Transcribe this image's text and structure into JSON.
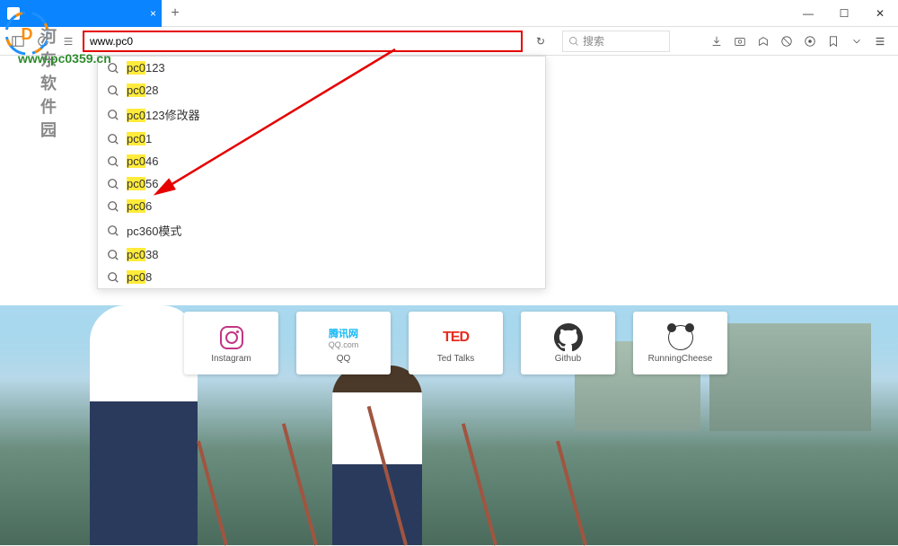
{
  "watermark": {
    "text_cn": "河东软件园",
    "url": "www.pc0359.cn"
  },
  "window": {
    "tab_close": "×",
    "newtab": "+",
    "minimize": "—",
    "maximize": "☐",
    "close": "✕"
  },
  "toolbar": {
    "url_value": "www.pc0",
    "reload": "↻",
    "search_placeholder": "搜索"
  },
  "suggestions": [
    {
      "prefix": "pc0",
      "suffix": "123"
    },
    {
      "prefix": "pc0",
      "suffix": "28"
    },
    {
      "prefix": "pc0",
      "suffix": "123修改器"
    },
    {
      "prefix": "pc0",
      "suffix": "1"
    },
    {
      "prefix": "pc0",
      "suffix": "46"
    },
    {
      "prefix": "pc0",
      "suffix": "56"
    },
    {
      "prefix": "pc0",
      "suffix": "6"
    },
    {
      "prefix": "",
      "suffix": "",
      "plain": "pc360模式"
    },
    {
      "prefix": "pc0",
      "suffix": "38"
    },
    {
      "prefix": "pc0",
      "suffix": "8"
    }
  ],
  "tiles": [
    {
      "label": "Instagram",
      "icon": "instagram"
    },
    {
      "label": "QQ",
      "icon": "qq",
      "sub1": "腾讯网",
      "sub2": "QQ.com"
    },
    {
      "label": "Ted Talks",
      "icon": "ted",
      "text": "TED"
    },
    {
      "label": "Github",
      "icon": "github"
    },
    {
      "label": "RunningCheese",
      "icon": "panda"
    }
  ]
}
